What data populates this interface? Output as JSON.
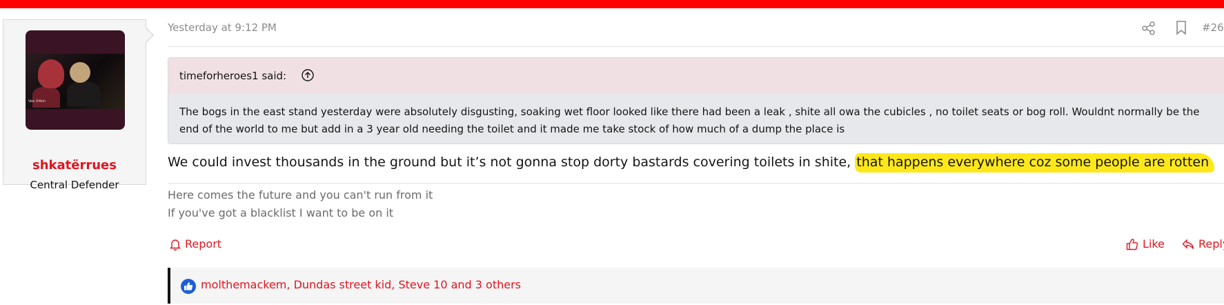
{
  "colors": {
    "accent_bar": "#ff0000",
    "link": "#e0141e",
    "highlight": "#ffe81a",
    "quote_head_bg": "#f0e0e4",
    "quote_body_bg": "#e6e8eb",
    "like_badge": "#1e5fd8"
  },
  "user": {
    "name": "shkatërrues",
    "title": "Central Defender",
    "avatar_caption": "Vee Vitkin"
  },
  "post": {
    "date": "Yesterday at 9:12 PM",
    "number": "#26",
    "quote": {
      "author": "timeforheroes1 said:",
      "text": "The bogs in the east stand yesterday were absolutely disgusting, soaking wet floor looked like there had been a leak , shite all owa the cubicles , no toilet seats or bog roll. Wouldnt normally be the end of the world to me but add in a 3 year old needing the toilet and it made me take stock of how much of a dump the place is"
    },
    "body_plain": "We could invest thousands in the ground but it’s not gonna stop dorty bastards covering toilets in shite,",
    "body_highlighted": "that happens everywhere coz some people are rotten",
    "signature": [
      "Here comes the future and you can't run from it",
      "If you've got a blacklist I want to be on it"
    ]
  },
  "actions": {
    "report_label": "Report",
    "like_label": "Like",
    "reply_label": "Reply"
  },
  "reactions": {
    "users_text": "molthemackem, Dundas street kid, Steve 10 and 3 others"
  },
  "icons": {
    "share": "share-icon",
    "bookmark": "bookmark-icon",
    "quote_jump": "arrow-up-circle-icon",
    "report": "bell-icon",
    "like": "thumbs-up-icon",
    "reply": "reply-icon",
    "reaction": "like-badge-icon"
  }
}
